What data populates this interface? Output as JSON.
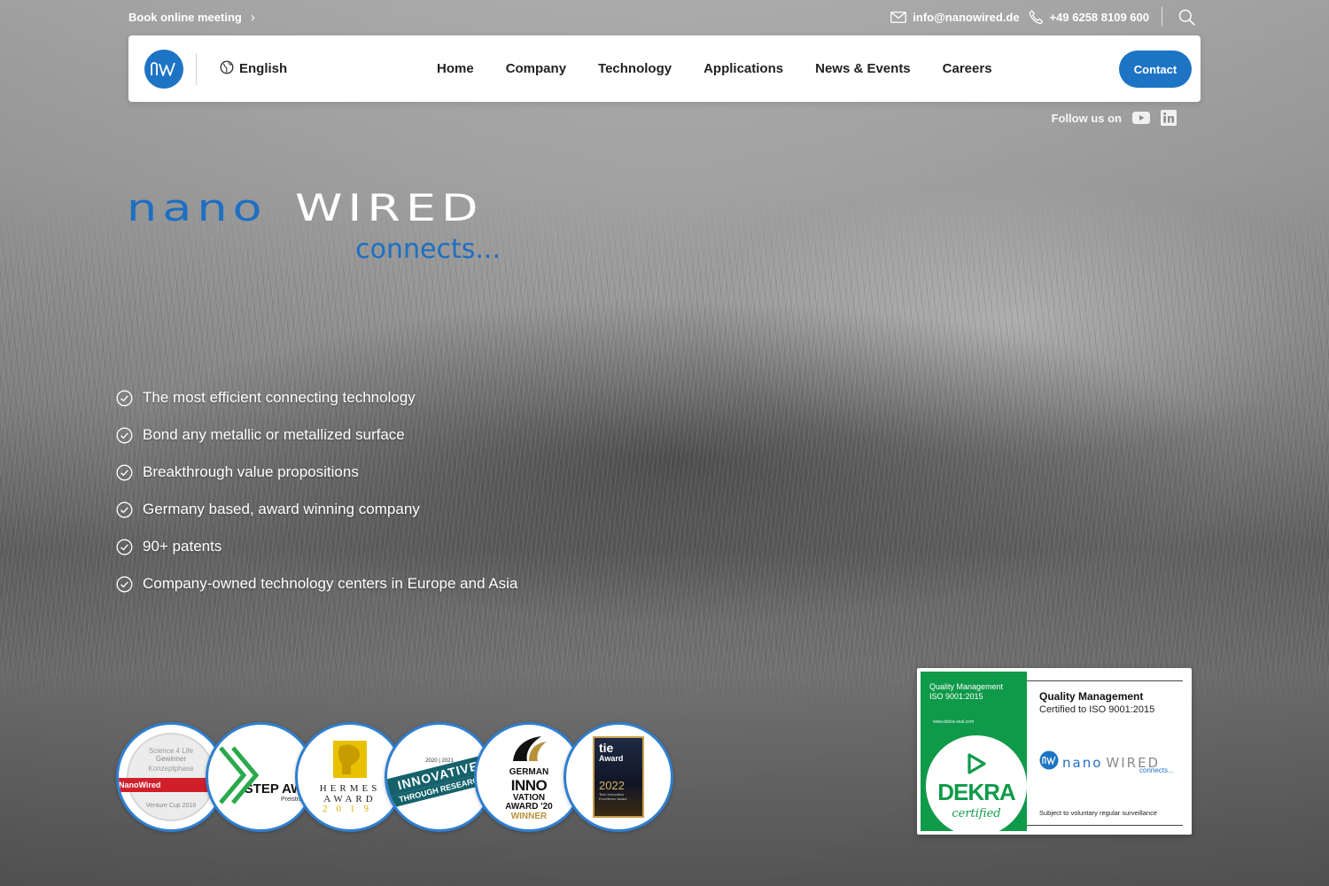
{
  "topbar": {
    "book_label": "Book online meeting",
    "email": "info@nanowired.de",
    "phone": "+49 6258 8109 600",
    "icons": [
      "chevron-right-icon",
      "mail-icon",
      "phone-icon",
      "search-icon"
    ]
  },
  "nav": {
    "language": "English",
    "menu": [
      "Home",
      "Company",
      "Technology",
      "Applications",
      "News & Events",
      "Careers"
    ],
    "contact_label": "Contact",
    "brand_color": "#1d74c4"
  },
  "follow": {
    "label": "Follow us on",
    "networks": [
      "youtube-icon",
      "linkedin-icon"
    ]
  },
  "hero": {
    "wordmark_nano": "nano",
    "wordmark_wired": "WIRED",
    "tagline": "connects...",
    "features": [
      "The most efficient connecting technology",
      "Bond any metallic or metallized surface",
      "Breakthrough value propositions",
      "Germany based, award winning company",
      "90+ patents",
      "Company-owned technology centers in Europe and Asia"
    ]
  },
  "awards": {
    "s4l": {
      "top": "Science 4 Life",
      "line1": "Gewinner",
      "line2": "Konzeptphase",
      "ribbon": "NanoWired",
      "bottom": "Venture Cup 2016"
    },
    "step": {
      "title": "STEP AW",
      "sub": "Preisträ"
    },
    "hermes": {
      "line1": "HERMES",
      "line2": "AWARD",
      "year": "2019"
    },
    "innovative": {
      "years": "2020 | 2021",
      "line1": "INNOVATIVE",
      "line2": "THROUGH RESEARCH"
    },
    "german_innovation": {
      "l1": "GERMAN",
      "l2": "INNO",
      "l3": "VATION",
      "l4": "AWARD '20",
      "l5": "WINNER"
    },
    "tie": {
      "l1": "tie",
      "l2": "Award",
      "year": "2022",
      "small": "Tech Innovation Excellence Award"
    }
  },
  "dekra": {
    "qm_line1": "Quality Management",
    "qm_line2": "ISO 9001:2015",
    "url": "www.dekra-seal.com",
    "word": "DEKRA",
    "certified": "certified",
    "right_title": "Quality Management",
    "right_sub": "Certified to ISO 9001:2015",
    "logo_nano": "nano",
    "logo_wired": "WIRED",
    "logo_connects": "connects...",
    "surveillance": "Subject to voluntary regular surveillance",
    "color": "#0f9a4a"
  }
}
